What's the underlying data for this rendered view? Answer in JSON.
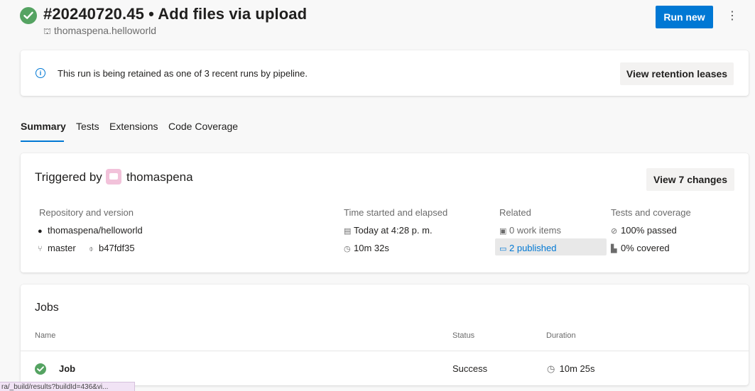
{
  "header": {
    "title": "#20240720.45 • Add files via upload",
    "repo": "thomaspena.helloworld",
    "run_new_label": "Run new",
    "more_label": "⋮"
  },
  "banner": {
    "message": "This run is being retained as one of 3 recent runs by pipeline.",
    "retention_label": "View retention leases"
  },
  "tabs": [
    {
      "label": "Summary",
      "active": true
    },
    {
      "label": "Tests",
      "active": false
    },
    {
      "label": "Extensions",
      "active": false
    },
    {
      "label": "Code Coverage",
      "active": false
    }
  ],
  "summary": {
    "triggered_by_label": "Triggered by",
    "triggered_by_user": "thomaspena",
    "view_changes_label": "View 7 changes",
    "repository": {
      "heading": "Repository and version",
      "repo": "thomaspena/helloworld",
      "branch": "master",
      "commit": "b47fdf35"
    },
    "time": {
      "heading": "Time started and elapsed",
      "started": "Today at 4:28 p. m.",
      "elapsed": "10m 32s"
    },
    "related": {
      "heading": "Related",
      "work_items": "0 work items",
      "published": "2 published"
    },
    "tests": {
      "heading": "Tests and coverage",
      "passed": "100% passed",
      "covered": "0% covered"
    }
  },
  "jobs": {
    "title": "Jobs",
    "columns": {
      "name": "Name",
      "status": "Status",
      "duration": "Duration"
    },
    "rows": [
      {
        "name": "Job",
        "status": "Success",
        "duration": "10m 25s"
      }
    ]
  },
  "status_bar": {
    "url": "ra/_build/results?buildId=436&vi..."
  },
  "colors": {
    "accent": "#0078d4",
    "success": "#55a362",
    "avatar": "#f2c2da"
  }
}
